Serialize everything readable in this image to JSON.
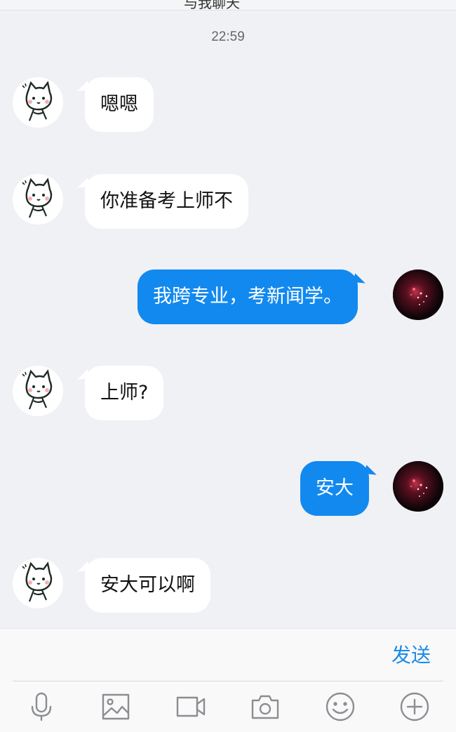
{
  "header": {
    "title_cut": "与我聊天"
  },
  "timestamp": "22:59",
  "messages": [
    {
      "side": "in",
      "text": "嗯嗯"
    },
    {
      "side": "in",
      "text": "你准备考上师不"
    },
    {
      "side": "out",
      "text": "我跨专业，考新闻学。"
    },
    {
      "side": "in",
      "text": "上师?"
    },
    {
      "side": "out",
      "text": "安大"
    },
    {
      "side": "in",
      "text": "安大可以啊"
    }
  ],
  "input": {
    "send_label": "发送"
  },
  "toolbar": {
    "icons": [
      "microphone-icon",
      "image-icon",
      "video-icon",
      "camera-icon",
      "emoji-icon",
      "plus-icon"
    ]
  },
  "colors": {
    "background": "#f0f1f4",
    "incoming_bubble": "#ffffff",
    "outgoing_bubble": "#1289ef",
    "send_text": "#1a8be8",
    "icon_gray": "#8b8d91"
  }
}
